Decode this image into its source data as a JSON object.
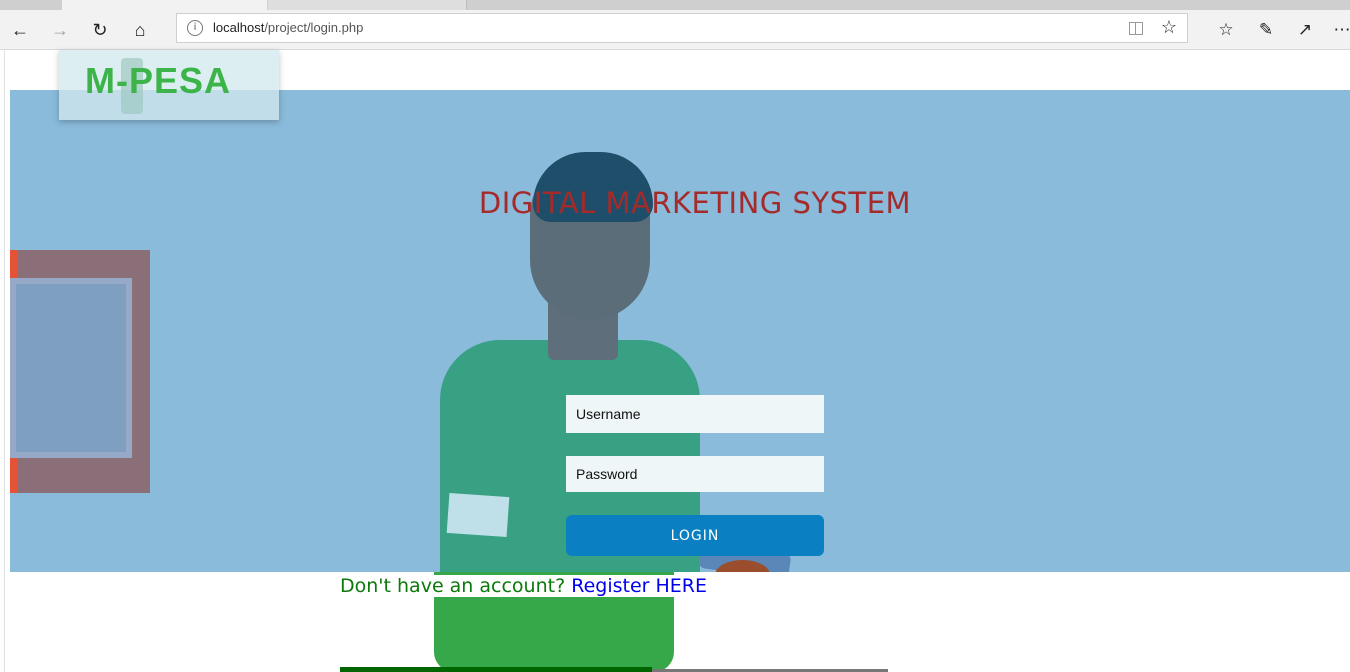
{
  "browser": {
    "back_icon": "arrow-left-icon",
    "forward_icon": "arrow-right-icon",
    "refresh_icon": "refresh-icon",
    "home_icon": "home-icon",
    "url_host": "localhost",
    "url_path": "/project/login.php",
    "reading_view_icon": "book-icon",
    "favorite_icon": "star-icon",
    "favorites_bar_icon": "favorites-list-icon",
    "notes_icon": "pen-icon",
    "share_icon": "share-icon",
    "more_icon": "more-icon"
  },
  "logo": {
    "text": "M-PESA",
    "color": "#3cb44a"
  },
  "page": {
    "title": "DIGITAL MARKETING SYSTEM",
    "username_placeholder": "Username",
    "password_placeholder": "Password",
    "login_label": "LOGIN",
    "register_prompt": "Don't have an account?",
    "register_link": "Register HERE"
  },
  "colors": {
    "banner": "#8abbdb",
    "title": "#a52a2a",
    "login_button": "#0a7fc2",
    "prompt": "#0a7a0a",
    "link": "#0000ee"
  }
}
